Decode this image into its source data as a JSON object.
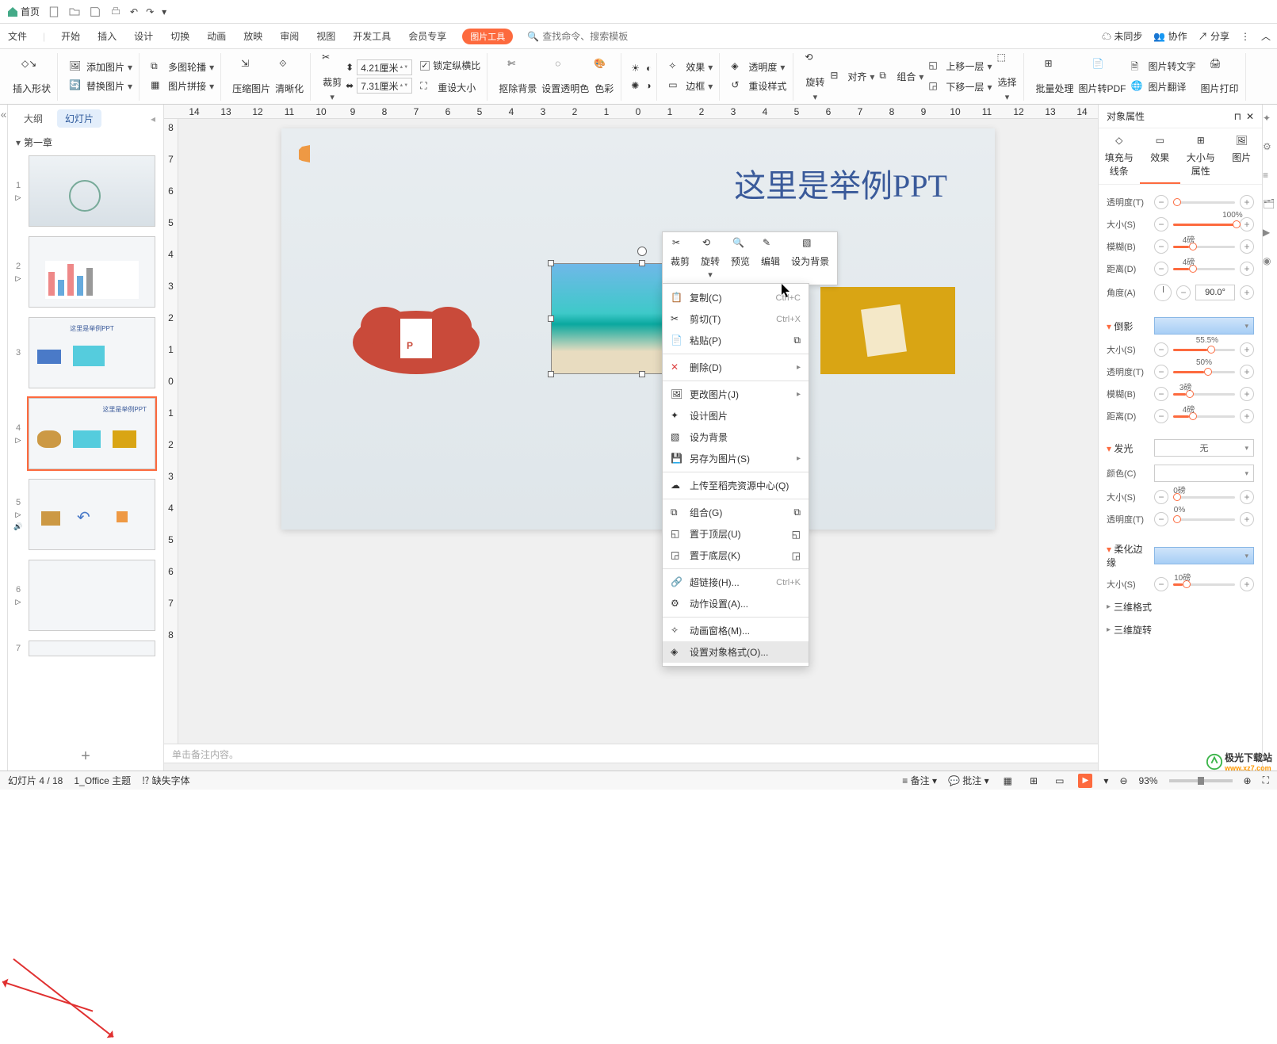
{
  "topbar": {
    "home": "首页"
  },
  "menu": {
    "file": "文件",
    "start": "开始",
    "insert": "插入",
    "design": "设计",
    "transition": "切换",
    "animation": "动画",
    "slideshow": "放映",
    "review": "审阅",
    "view": "视图",
    "devtools": "开发工具",
    "member": "会员专享",
    "pictool": "图片工具",
    "search_ph": "查找命令、搜索模板",
    "unsync": "未同步",
    "collab": "协作",
    "share": "分享"
  },
  "ribbon": {
    "insert_shape": "插入形状",
    "add_image": "添加图片",
    "multi_carousel": "多图轮播",
    "replace_image": "替换图片",
    "image_stitch": "图片拼接",
    "compress": "压缩图片",
    "sharpen": "清晰化",
    "crop": "裁剪",
    "w": "4.21厘米",
    "h": "7.31厘米",
    "lock_ratio": "锁定纵横比",
    "reset_size": "重设大小",
    "remove_bg": "抠除背景",
    "set_transparent": "设置透明色",
    "color": "色彩",
    "effect": "效果",
    "transparency": "透明度",
    "border": "边框",
    "reset_style": "重设样式",
    "rotate": "旋转",
    "align": "对齐",
    "group": "组合",
    "bring_fwd": "上移一层",
    "send_back": "下移一层",
    "select": "选择",
    "batch": "批量处理",
    "to_pdf": "图片转PDF",
    "to_text": "图片转文字",
    "translate": "图片翻译",
    "print": "图片打印"
  },
  "sidebar": {
    "outline": "大纲",
    "slides": "幻灯片",
    "chapter": "第一章"
  },
  "slide": {
    "title": "这里是举例PPT"
  },
  "thumb_titles": {
    "3": "这里是举例PPT",
    "4": "这里是举例PPT"
  },
  "float": {
    "crop": "裁剪",
    "rotate": "旋转",
    "preview": "预览",
    "edit": "编辑",
    "set_bg": "设为背景"
  },
  "ctx": {
    "copy": "复制(C)",
    "copy_sc": "Ctrl+C",
    "cut": "剪切(T)",
    "cut_sc": "Ctrl+X",
    "paste": "粘贴(P)",
    "delete": "删除(D)",
    "change_pic": "更改图片(J)",
    "design_pic": "设计图片",
    "set_bg": "设为背景",
    "save_as_pic": "另存为图片(S)",
    "upload": "上传至稻壳资源中心(Q)",
    "group": "组合(G)",
    "bring_top": "置于顶层(U)",
    "send_bottom": "置于底层(K)",
    "hyperlink": "超链接(H)...",
    "hyperlink_sc": "Ctrl+K",
    "action": "动作设置(A)...",
    "anim_pane": "动画窗格(M)...",
    "format_obj": "设置对象格式(O)..."
  },
  "notes_ph": "单击备注内容。",
  "panel": {
    "title": "对象属性",
    "tabs": {
      "fill": "填充与线条",
      "effect": "效果",
      "size": "大小与属性",
      "pic": "图片"
    },
    "transparency_t": "透明度(T)",
    "size_s": "大小(S)",
    "size_val": "100%",
    "blur_b": "模糊(B)",
    "blur_val": "4磅",
    "distance_d": "距离(D)",
    "dist_val": "4磅",
    "angle_a": "角度(A)",
    "angle_val": "90.0°",
    "reflection": "倒影",
    "refl_size_val": "55.5%",
    "refl_trans_val": "50%",
    "refl_blur_val": "3磅",
    "refl_dist_val": "4磅",
    "glow": "发光",
    "glow_none": "无",
    "color_c": "颜色(C)",
    "glow_size_val": "0磅",
    "glow_trans_val": "0%",
    "soft_edge": "柔化边缘",
    "soft_size_val": "10磅",
    "fmt3d": "三维格式",
    "rot3d": "三维旋转"
  },
  "status": {
    "slide": "幻灯片 4 / 18",
    "theme": "1_Office 主题",
    "missing_font": "缺失字体",
    "notes": "备注",
    "comments": "批注",
    "zoom": "93%"
  },
  "watermark": "极光下载站",
  "watermark_url": "www.xz7.com"
}
